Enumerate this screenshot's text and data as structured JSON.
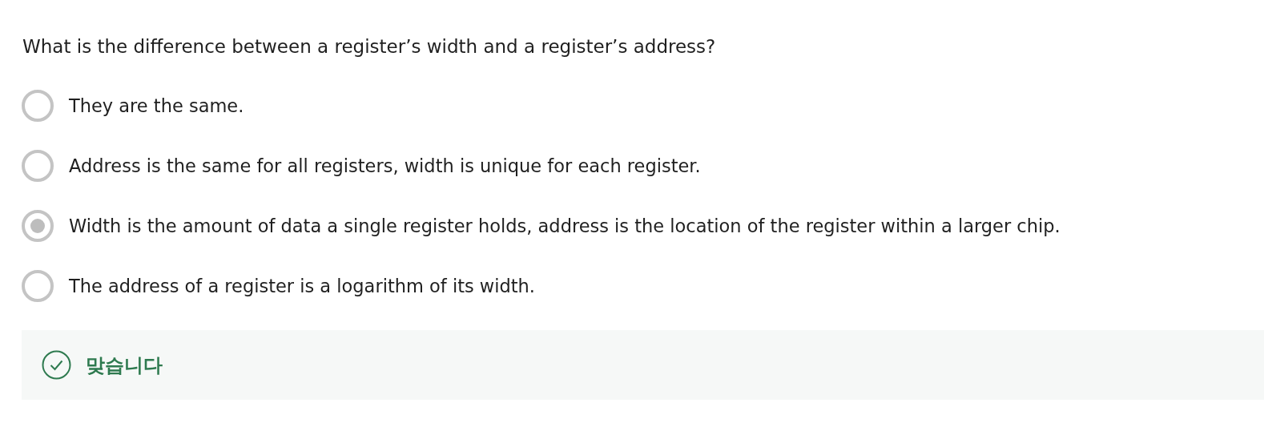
{
  "question": "What is the difference between a register’s width and a register’s address?",
  "options": [
    {
      "label": "They are the same.",
      "selected": false
    },
    {
      "label": "Address is the same for all registers, width is unique for each register.",
      "selected": false
    },
    {
      "label": "Width is the amount of data a single register holds, address is the location of the register within a larger chip.",
      "selected": true
    },
    {
      "label": "The address of a register is a logarithm of its width.",
      "selected": false
    }
  ],
  "feedback": {
    "kind": "correct",
    "text": "맞습니다"
  }
}
